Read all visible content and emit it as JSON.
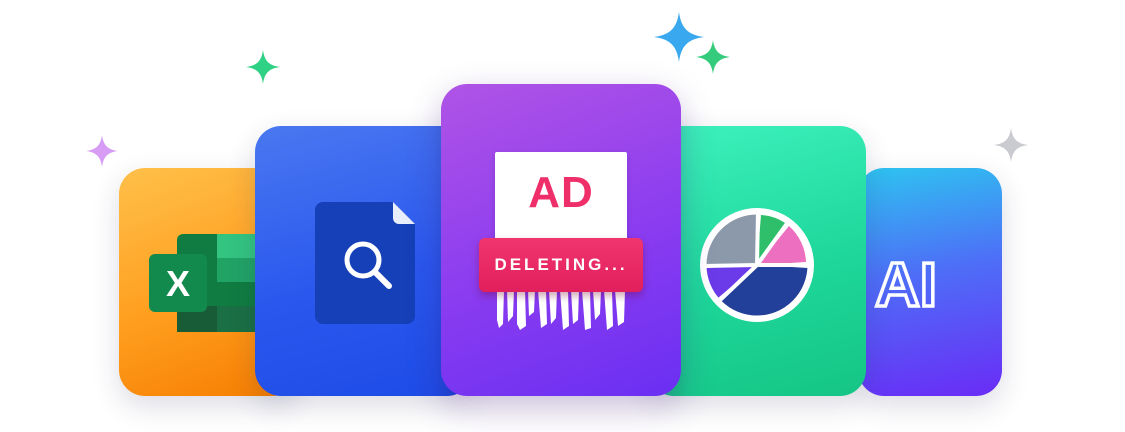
{
  "cards": {
    "excel": {
      "label": "X",
      "icon": "excel-icon",
      "color": "#ff9e1e"
    },
    "search": {
      "icon": "search-document-icon",
      "color": "#2a58ee"
    },
    "center": {
      "ad_text": "AD",
      "status_text": "DELETING...",
      "icon": "shredder-icon",
      "color": "#8a3cf0",
      "accent": "#ee2f6a"
    },
    "chart": {
      "icon": "pie-chart-icon",
      "color": "#1ed79a"
    },
    "ai": {
      "label": "AI",
      "icon": "ai-icon",
      "color": "#4d6ff7"
    }
  },
  "sparkles": [
    {
      "name": "sparkle-green-left",
      "color": "#2fd184"
    },
    {
      "name": "sparkle-lilac-left",
      "color": "#d79cf4"
    },
    {
      "name": "sparkle-blue-top",
      "color": "#3aa8ee"
    },
    {
      "name": "sparkle-green-top",
      "color": "#34cc7c"
    },
    {
      "name": "sparkle-gray-right",
      "color": "#c9cbd1"
    }
  ]
}
